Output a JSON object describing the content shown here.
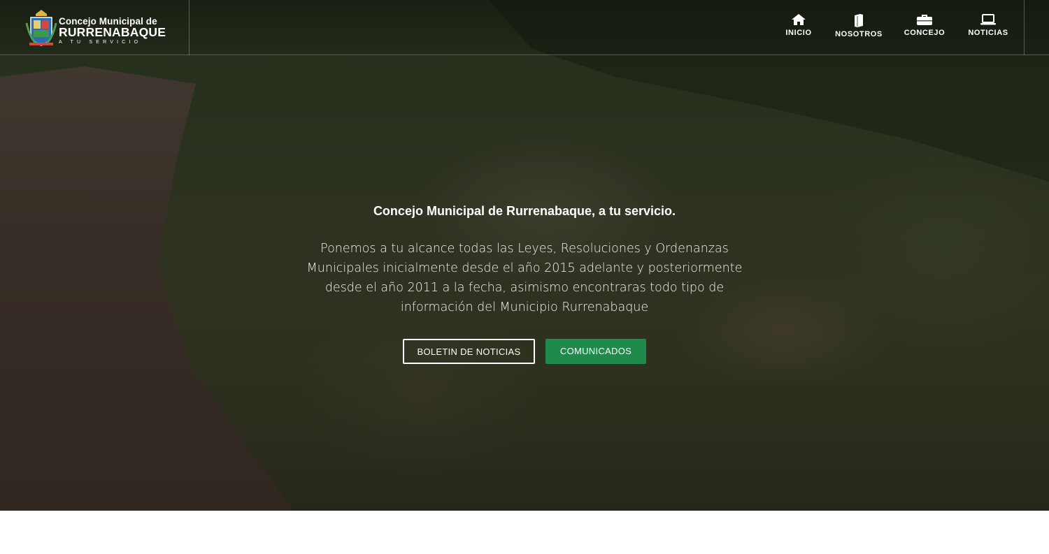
{
  "logo": {
    "line1": "Concejo Municipal de",
    "line2": "RURRENABAQUE",
    "tagline": "A TU SERVICIO"
  },
  "nav": {
    "items": [
      {
        "label": "INICIO",
        "icon": "home-icon"
      },
      {
        "label": "NOSOTROS",
        "icon": "book-icon"
      },
      {
        "label": "CONCEJO",
        "icon": "briefcase-icon"
      },
      {
        "label": "NOTICIAS",
        "icon": "laptop-icon"
      }
    ]
  },
  "hero": {
    "headline": "Concejo Municipal de Rurrenabaque, a tu servicio.",
    "description": "Ponemos a tu alcance todas las Leyes, Resoluciones y Ordenanzas Municipales inicialmente desde el año 2015 adelante y posteriormente desde el año 2011 a la fecha, asimismo encontraras todo tipo de información del Municipio Rurrenabaque",
    "buttons": {
      "newsletter": "BOLETIN DE NOTICIAS",
      "announcements": "COMUNICADOS"
    }
  },
  "colors": {
    "accent_green": "#1e8a4c",
    "text_light": "#ffffff"
  }
}
